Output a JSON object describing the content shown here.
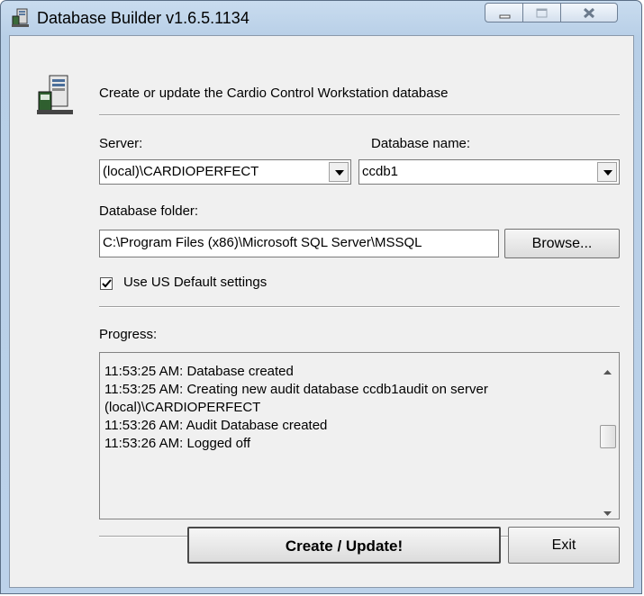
{
  "window": {
    "title": "Database Builder v1.6.5.1134"
  },
  "intro": "Create or update the Cardio Control Workstation database",
  "server": {
    "label": "Server:",
    "value": "(local)\\CARDIOPERFECT"
  },
  "database": {
    "label": "Database name:",
    "value": "ccdb1"
  },
  "folder": {
    "label": "Database folder:",
    "value": "C:\\Program Files (x86)\\Microsoft SQL Server\\MSSQL",
    "browse_label": "Browse..."
  },
  "us_defaults": {
    "label": "Use US Default settings",
    "checked": true
  },
  "progress": {
    "label": "Progress:",
    "lines": [
      "11:53:25 AM: Database created",
      "11:53:25 AM: Creating new audit database ccdb1audit on server (local)\\CARDIOPERFECT",
      "11:53:26 AM: Audit Database created",
      "11:53:26 AM: Logged off"
    ]
  },
  "buttons": {
    "create": "Create / Update!",
    "exit": "Exit"
  }
}
